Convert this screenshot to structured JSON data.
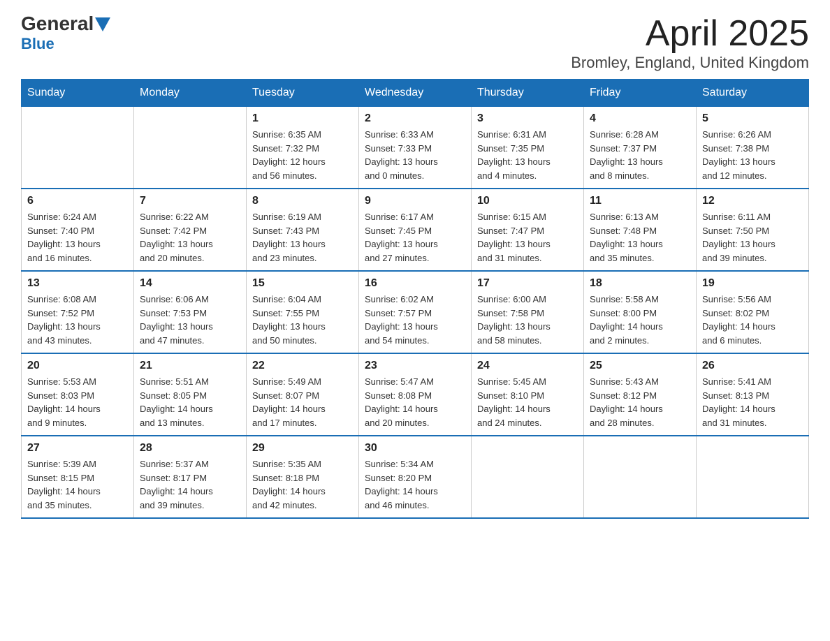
{
  "logo": {
    "line1a": "General",
    "line1b": "Blue",
    "line2": "Blue"
  },
  "title": "April 2025",
  "subtitle": "Bromley, England, United Kingdom",
  "days_of_week": [
    "Sunday",
    "Monday",
    "Tuesday",
    "Wednesday",
    "Thursday",
    "Friday",
    "Saturday"
  ],
  "weeks": [
    [
      {
        "day": "",
        "info": ""
      },
      {
        "day": "",
        "info": ""
      },
      {
        "day": "1",
        "info": "Sunrise: 6:35 AM\nSunset: 7:32 PM\nDaylight: 12 hours\nand 56 minutes."
      },
      {
        "day": "2",
        "info": "Sunrise: 6:33 AM\nSunset: 7:33 PM\nDaylight: 13 hours\nand 0 minutes."
      },
      {
        "day": "3",
        "info": "Sunrise: 6:31 AM\nSunset: 7:35 PM\nDaylight: 13 hours\nand 4 minutes."
      },
      {
        "day": "4",
        "info": "Sunrise: 6:28 AM\nSunset: 7:37 PM\nDaylight: 13 hours\nand 8 minutes."
      },
      {
        "day": "5",
        "info": "Sunrise: 6:26 AM\nSunset: 7:38 PM\nDaylight: 13 hours\nand 12 minutes."
      }
    ],
    [
      {
        "day": "6",
        "info": "Sunrise: 6:24 AM\nSunset: 7:40 PM\nDaylight: 13 hours\nand 16 minutes."
      },
      {
        "day": "7",
        "info": "Sunrise: 6:22 AM\nSunset: 7:42 PM\nDaylight: 13 hours\nand 20 minutes."
      },
      {
        "day": "8",
        "info": "Sunrise: 6:19 AM\nSunset: 7:43 PM\nDaylight: 13 hours\nand 23 minutes."
      },
      {
        "day": "9",
        "info": "Sunrise: 6:17 AM\nSunset: 7:45 PM\nDaylight: 13 hours\nand 27 minutes."
      },
      {
        "day": "10",
        "info": "Sunrise: 6:15 AM\nSunset: 7:47 PM\nDaylight: 13 hours\nand 31 minutes."
      },
      {
        "day": "11",
        "info": "Sunrise: 6:13 AM\nSunset: 7:48 PM\nDaylight: 13 hours\nand 35 minutes."
      },
      {
        "day": "12",
        "info": "Sunrise: 6:11 AM\nSunset: 7:50 PM\nDaylight: 13 hours\nand 39 minutes."
      }
    ],
    [
      {
        "day": "13",
        "info": "Sunrise: 6:08 AM\nSunset: 7:52 PM\nDaylight: 13 hours\nand 43 minutes."
      },
      {
        "day": "14",
        "info": "Sunrise: 6:06 AM\nSunset: 7:53 PM\nDaylight: 13 hours\nand 47 minutes."
      },
      {
        "day": "15",
        "info": "Sunrise: 6:04 AM\nSunset: 7:55 PM\nDaylight: 13 hours\nand 50 minutes."
      },
      {
        "day": "16",
        "info": "Sunrise: 6:02 AM\nSunset: 7:57 PM\nDaylight: 13 hours\nand 54 minutes."
      },
      {
        "day": "17",
        "info": "Sunrise: 6:00 AM\nSunset: 7:58 PM\nDaylight: 13 hours\nand 58 minutes."
      },
      {
        "day": "18",
        "info": "Sunrise: 5:58 AM\nSunset: 8:00 PM\nDaylight: 14 hours\nand 2 minutes."
      },
      {
        "day": "19",
        "info": "Sunrise: 5:56 AM\nSunset: 8:02 PM\nDaylight: 14 hours\nand 6 minutes."
      }
    ],
    [
      {
        "day": "20",
        "info": "Sunrise: 5:53 AM\nSunset: 8:03 PM\nDaylight: 14 hours\nand 9 minutes."
      },
      {
        "day": "21",
        "info": "Sunrise: 5:51 AM\nSunset: 8:05 PM\nDaylight: 14 hours\nand 13 minutes."
      },
      {
        "day": "22",
        "info": "Sunrise: 5:49 AM\nSunset: 8:07 PM\nDaylight: 14 hours\nand 17 minutes."
      },
      {
        "day": "23",
        "info": "Sunrise: 5:47 AM\nSunset: 8:08 PM\nDaylight: 14 hours\nand 20 minutes."
      },
      {
        "day": "24",
        "info": "Sunrise: 5:45 AM\nSunset: 8:10 PM\nDaylight: 14 hours\nand 24 minutes."
      },
      {
        "day": "25",
        "info": "Sunrise: 5:43 AM\nSunset: 8:12 PM\nDaylight: 14 hours\nand 28 minutes."
      },
      {
        "day": "26",
        "info": "Sunrise: 5:41 AM\nSunset: 8:13 PM\nDaylight: 14 hours\nand 31 minutes."
      }
    ],
    [
      {
        "day": "27",
        "info": "Sunrise: 5:39 AM\nSunset: 8:15 PM\nDaylight: 14 hours\nand 35 minutes."
      },
      {
        "day": "28",
        "info": "Sunrise: 5:37 AM\nSunset: 8:17 PM\nDaylight: 14 hours\nand 39 minutes."
      },
      {
        "day": "29",
        "info": "Sunrise: 5:35 AM\nSunset: 8:18 PM\nDaylight: 14 hours\nand 42 minutes."
      },
      {
        "day": "30",
        "info": "Sunrise: 5:34 AM\nSunset: 8:20 PM\nDaylight: 14 hours\nand 46 minutes."
      },
      {
        "day": "",
        "info": ""
      },
      {
        "day": "",
        "info": ""
      },
      {
        "day": "",
        "info": ""
      }
    ]
  ]
}
